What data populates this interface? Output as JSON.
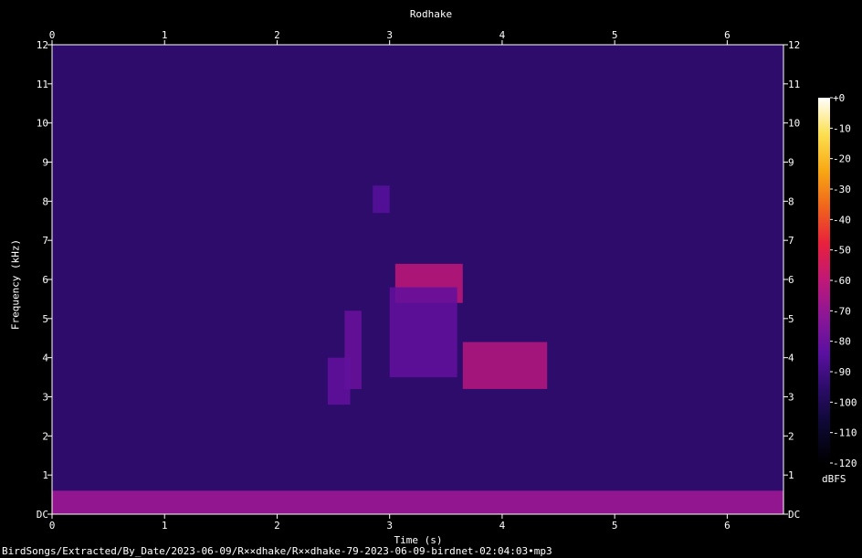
{
  "chart_data": {
    "type": "heatmap",
    "title": "Rodhake",
    "xlabel": "Time (s)",
    "ylabel": "Frequency (kHz)",
    "xlim": [
      0,
      6.5
    ],
    "ylim": [
      0,
      12
    ],
    "x_ticks": [
      "0",
      "1",
      "2",
      "3",
      "4",
      "5",
      "6"
    ],
    "y_ticks": [
      "DC",
      "1",
      "2",
      "3",
      "4",
      "5",
      "6",
      "7",
      "8",
      "9",
      "10",
      "11",
      "12"
    ],
    "colorbar": {
      "ticks": [
        "+0",
        "-10",
        "-20",
        "-30",
        "-40",
        "-50",
        "-60",
        "-70",
        "-80",
        "-90",
        "-100",
        "-110",
        "-120"
      ],
      "min": -120,
      "max": 0,
      "unit": "dBFS",
      "colors": [
        "#000000",
        "#0c0830",
        "#2a0c66",
        "#5a10a0",
        "#8a1696",
        "#c01878",
        "#e8203c",
        "#f0641c",
        "#f8a814",
        "#fce050",
        "#ffffff"
      ]
    },
    "background_level_dbfs": -95,
    "low_freq_band": {
      "f_max_khz": 0.6,
      "level_dbfs": -70
    },
    "signal_regions": [
      {
        "t": [
          3.65,
          4.4
        ],
        "f": [
          3.2,
          4.4
        ],
        "level_dbfs": -62
      },
      {
        "t": [
          3.05,
          3.65
        ],
        "f": [
          5.4,
          6.4
        ],
        "level_dbfs": -60
      },
      {
        "t": [
          3.0,
          3.6
        ],
        "f": [
          3.5,
          5.8
        ],
        "level_dbfs": -82
      },
      {
        "t": [
          2.6,
          2.75
        ],
        "f": [
          3.2,
          5.2
        ],
        "level_dbfs": -80
      },
      {
        "t": [
          2.45,
          2.65
        ],
        "f": [
          2.8,
          4.0
        ],
        "level_dbfs": -82
      },
      {
        "t": [
          2.85,
          3.0
        ],
        "f": [
          7.7,
          8.4
        ],
        "level_dbfs": -85
      }
    ]
  },
  "footer": {
    "file_path": "BirdSongs/Extracted/By_Date/2023-06-09/R××dhake/R××dhake-79-2023-06-09-birdnet-02:04:03•mp3"
  }
}
